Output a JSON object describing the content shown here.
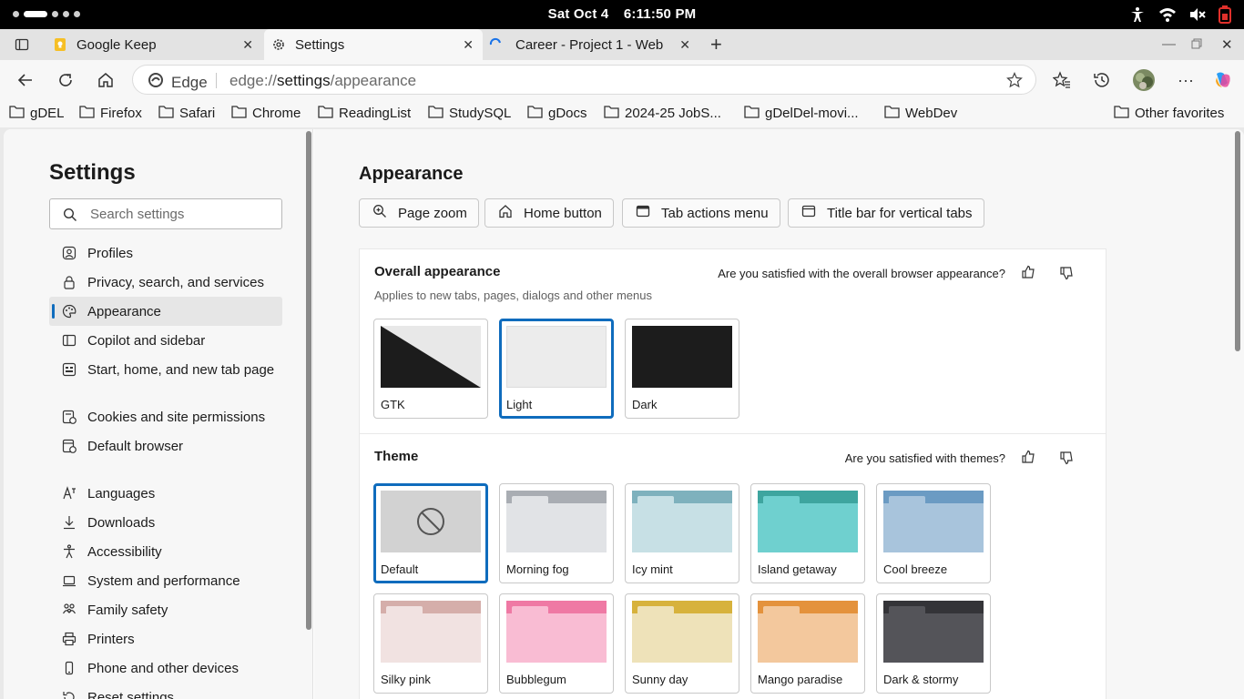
{
  "status_bar": {
    "date": "Sat Oct 4",
    "time": "6:11:50 PM"
  },
  "tabs": [
    {
      "title": "Google Keep",
      "icon": "google-keep-icon"
    },
    {
      "title": "Settings",
      "icon": "gear-icon"
    },
    {
      "title": "Career - Project 1 - Web",
      "icon": "loading-spinner-icon"
    }
  ],
  "toolbar": {
    "edge_label": "Edge",
    "url_scheme": "edge://",
    "url_host": "settings",
    "url_path": "/appearance"
  },
  "favorites": [
    "gDEL",
    "Firefox",
    "Safari",
    "Chrome",
    "ReadingList",
    "StudySQL",
    "gDocs",
    "2024-25 JobS...",
    "gDelDel-movi...",
    "WebDev"
  ],
  "other_favorites": "Other favorites",
  "sidebar": {
    "title": "Settings",
    "search_placeholder": "Search settings",
    "items": [
      {
        "label": "Profiles",
        "icon": "profile-icon"
      },
      {
        "label": "Privacy, search, and services",
        "icon": "lock-icon"
      },
      {
        "label": "Appearance",
        "icon": "palette-icon",
        "active": true
      },
      {
        "label": "Copilot and sidebar",
        "icon": "sidebar-icon"
      },
      {
        "label": "Start, home, and new tab page",
        "icon": "home-grid-icon"
      },
      {
        "label": "Cookies and site permissions",
        "icon": "cookie-icon"
      },
      {
        "label": "Default browser",
        "icon": "browser-icon"
      },
      {
        "label": "Languages",
        "icon": "language-icon"
      },
      {
        "label": "Downloads",
        "icon": "download-icon"
      },
      {
        "label": "Accessibility",
        "icon": "accessibility-icon"
      },
      {
        "label": "System and performance",
        "icon": "laptop-icon"
      },
      {
        "label": "Family safety",
        "icon": "family-icon"
      },
      {
        "label": "Printers",
        "icon": "printer-icon"
      },
      {
        "label": "Phone and other devices",
        "icon": "phone-icon"
      },
      {
        "label": "Reset settings",
        "icon": "reset-icon"
      }
    ]
  },
  "main": {
    "title": "Appearance",
    "chips": [
      {
        "label": "Page zoom",
        "icon": "zoom-icon"
      },
      {
        "label": "Home button",
        "icon": "home-icon"
      },
      {
        "label": "Tab actions menu",
        "icon": "tab-menu-icon"
      },
      {
        "label": "Title bar for vertical tabs",
        "icon": "window-icon"
      }
    ],
    "overall": {
      "title": "Overall appearance",
      "subtitle": "Applies to new tabs, pages, dialogs and other menus",
      "feedback": "Are you satisfied with the overall browser appearance?",
      "options": [
        {
          "label": "GTK",
          "selected": false
        },
        {
          "label": "Light",
          "selected": true
        },
        {
          "label": "Dark",
          "selected": false
        }
      ]
    },
    "theme": {
      "title": "Theme",
      "feedback": "Are you satisfied with themes?",
      "options": [
        {
          "label": "Default",
          "selected": true,
          "bar": "#d2d2d2",
          "body": "#d2d2d2",
          "folder": "#d2d2d2"
        },
        {
          "label": "Morning fog",
          "selected": false,
          "bar": "#a9adb3",
          "body": "#e1e3e6",
          "folder": "#e1e3e6"
        },
        {
          "label": "Icy mint",
          "selected": false,
          "bar": "#7eb1bd",
          "body": "#c7e0e5",
          "folder": "#c7e0e5"
        },
        {
          "label": "Island getaway",
          "selected": false,
          "bar": "#3ea59f",
          "body": "#6fd0cf",
          "folder": "#6fd0cf"
        },
        {
          "label": "Cool breeze",
          "selected": false,
          "bar": "#6b9bc3",
          "body": "#a8c4dc",
          "folder": "#a8c4dc"
        },
        {
          "label": "Silky pink",
          "selected": false,
          "bar": "#d5aeaa",
          "body": "#f1e2e1",
          "folder": "#f1e2e1"
        },
        {
          "label": "Bubblegum",
          "selected": false,
          "bar": "#ef79a4",
          "body": "#f9bcd3",
          "folder": "#f9bcd3"
        },
        {
          "label": "Sunny day",
          "selected": false,
          "bar": "#d7b23c",
          "body": "#eee2b9",
          "folder": "#eee2b9"
        },
        {
          "label": "Mango paradise",
          "selected": false,
          "bar": "#e4923c",
          "body": "#f3c89d",
          "folder": "#f3c89d"
        },
        {
          "label": "Dark & stormy",
          "selected": false,
          "bar": "#343438",
          "body": "#545459",
          "folder": "#545459"
        }
      ]
    }
  },
  "colors": {
    "accent": "#0f6cbd",
    "selected_border": "#0f6cbd"
  }
}
